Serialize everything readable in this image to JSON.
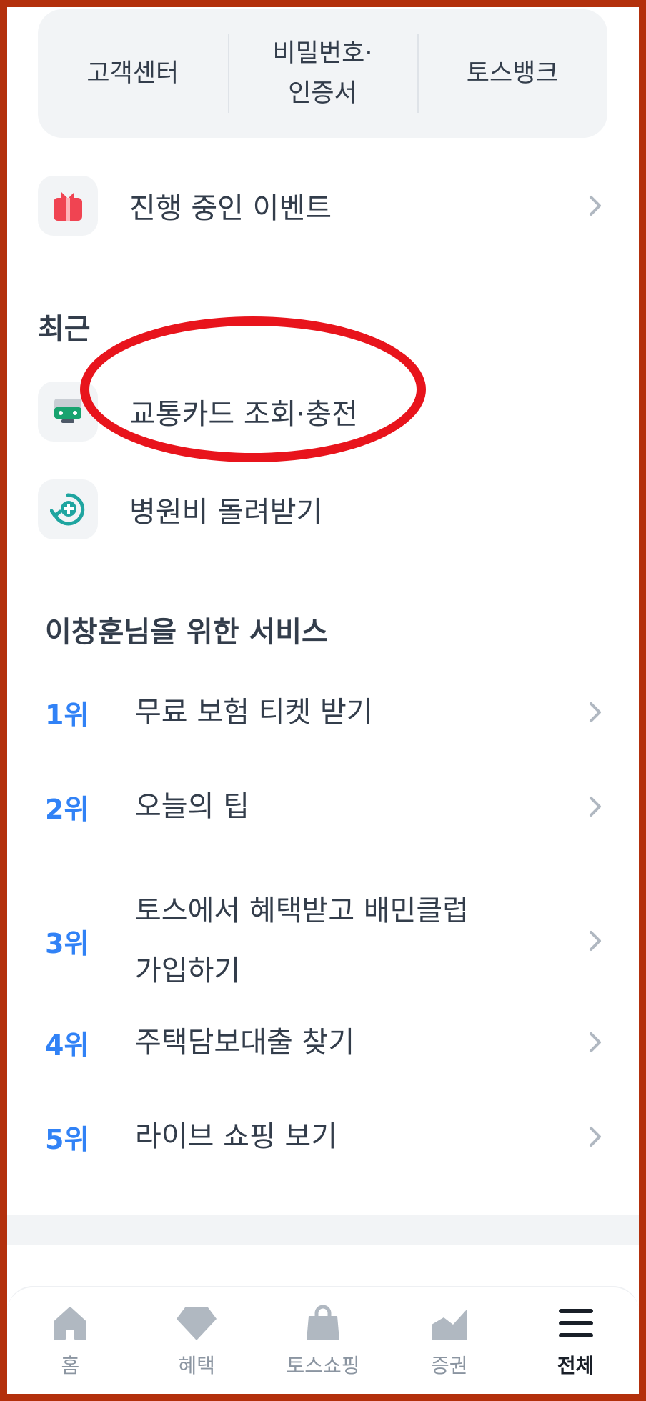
{
  "quick_menu": {
    "items": [
      {
        "label": "고객센터"
      },
      {
        "label": "비밀번호·\n인증서"
      },
      {
        "label": "토스뱅크"
      }
    ]
  },
  "events": {
    "label": "진행 중인 이벤트",
    "icon": "gift-icon"
  },
  "recent": {
    "title": "최근",
    "items": [
      {
        "label": "교통카드 조회·충전",
        "icon": "bus-card-icon"
      },
      {
        "label": "병원비 돌려받기",
        "icon": "hospital-refund-icon"
      }
    ]
  },
  "services": {
    "title": "이창훈님을 위한 서비스",
    "items": [
      {
        "rank": "1위",
        "label": "무료 보험 티켓 받기"
      },
      {
        "rank": "2위",
        "label": "오늘의 팁"
      },
      {
        "rank": "3위",
        "label": "토스에서 혜택받고 배민클럽\n가입하기"
      },
      {
        "rank": "4위",
        "label": "주택담보대출 찾기"
      },
      {
        "rank": "5위",
        "label": "라이브 쇼핑 보기"
      }
    ]
  },
  "tabbar": {
    "tabs": [
      {
        "label": "홈",
        "icon": "home-icon"
      },
      {
        "label": "혜택",
        "icon": "gem-icon"
      },
      {
        "label": "토스쇼핑",
        "icon": "shopping-bag-icon"
      },
      {
        "label": "증권",
        "icon": "stock-chart-icon"
      },
      {
        "label": "전체",
        "icon": "menu-icon",
        "active": true
      }
    ]
  },
  "colors": {
    "accent": "#3182f6",
    "text": "#333d4b",
    "tile_bg": "#f2f4f6",
    "annotation": "#e8141c",
    "frame": "#b3300c"
  }
}
